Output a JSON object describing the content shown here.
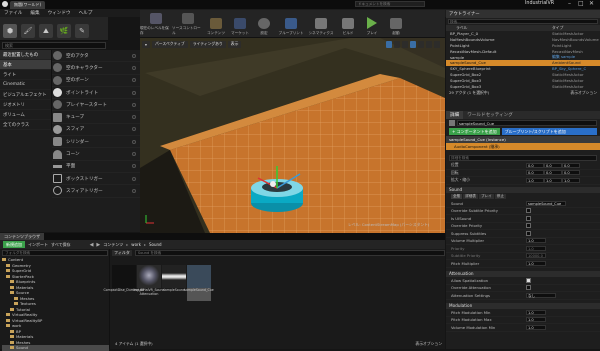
{
  "document_tab": "無題(ワールド)",
  "window_title": "IndustrialVR",
  "help_search_placeholder": "ドキュメントを検索",
  "menu": [
    "ファイル",
    "編集",
    "ウィンドウ",
    "ヘルプ"
  ],
  "modes_title": "モード",
  "place_search_placeholder": "検索",
  "place_categories": [
    "最近配置したもの",
    "基本",
    "ライト",
    "Cinematic",
    "ビジュアルエフェクト",
    "ジオメトリ",
    "ボリューム",
    "全てのクラス"
  ],
  "place_items": [
    "空のアクタ",
    "空のキャラクター",
    "空のポーン",
    "ポイントライト",
    "プレイヤースタート",
    "キューブ",
    "スフィア",
    "シリンダー",
    "コーン",
    "平面",
    "ボックストリガー",
    "スフィアトリガー"
  ],
  "toolbar": [
    "現在のレベルを保存",
    "ソースコントロール",
    "コンテンツ",
    "マーケット",
    "設定",
    "ブループリント",
    "シネマティクス",
    "ビルド",
    "プレイ",
    "起動"
  ],
  "viewport": {
    "perspective": "パースペクティブ",
    "lit": "ライティングあり",
    "show": "表示",
    "status": "レベル: ContentStreamMap (パーシスタント)"
  },
  "outliner": {
    "title": "アウトライナー",
    "search_placeholder": "検索...",
    "col_label": "ラベル",
    "col_type": "タイプ",
    "rows": [
      {
        "label": "BP_Player_C_0",
        "type": "StaticMeshActor"
      },
      {
        "label": "NoMeshBoundsVolume",
        "type": "NavMeshBoundsVolume"
      },
      {
        "label": "PointLight",
        "type": "PointLight"
      },
      {
        "label": "RecastNavMesh-Default",
        "type": "RecastNavMesh"
      },
      {
        "label": "sample",
        "type": "編集 sample"
      },
      {
        "label": "sampleSound_Cue",
        "type": "AmbientSound"
      },
      {
        "label": "SKY_SphereBlueprint",
        "type": "BP_Sky_Sphere_C"
      },
      {
        "label": "SuperGrid_Box2",
        "type": "StaticMeshActor"
      },
      {
        "label": "SuperGrid_Box3",
        "type": "StaticMeshActor"
      },
      {
        "label": "SuperGrid_Box3",
        "type": "StaticMeshActor"
      }
    ],
    "footer": "29 アクタ (1 を選択中)",
    "view_options": "表示オプション"
  },
  "details": {
    "tab": "詳細",
    "tab2": "ワールドセッティング",
    "actor_name": "sampleSound_Cue",
    "add_component": "+ コンポーネントを追加",
    "blueprint_button": "ブループリント/スクリプトを追加",
    "instance": "sampleSound_Cue (Instance)",
    "component": "AudioComponent (継承)",
    "search_placeholder": "詳細を検索",
    "transform": {
      "location": "位置",
      "rotation": "回転",
      "scale": "拡大・縮小"
    },
    "sound_section": "Sound",
    "sound_tabs": [
      "全般",
      "詳細表",
      "プレイ",
      "停止"
    ],
    "sound_label": "Sound",
    "sound_value": "sampleSound_Cue",
    "sound_rows": [
      {
        "label": "Override Subtitle Priority",
        "v": "chk"
      },
      {
        "label": "Is UISound",
        "v": "chk"
      },
      {
        "label": "Override Priority",
        "v": "chk"
      },
      {
        "label": "Suppress Subtitles",
        "v": "chk"
      },
      {
        "label": "Volume Multiplier",
        "v": "1.0"
      },
      {
        "label": "Priority",
        "v": "1.0"
      },
      {
        "label": "Subtitle Priority",
        "v": "10000.0"
      },
      {
        "label": "Pitch Multiplier",
        "v": "1.0"
      }
    ],
    "attenuation_section": "Attenuation",
    "attenuation_rows": [
      {
        "label": "Allow Spatialization",
        "v": "chkon"
      },
      {
        "label": "Override Attenuation",
        "v": "chk"
      },
      {
        "label": "Attenuation Settings",
        "v": "なし"
      }
    ],
    "modulation_section": "Modulation",
    "modulation_rows": [
      {
        "label": "Pitch Modulation Min",
        "v": "1.0"
      },
      {
        "label": "Pitch Modulation Max",
        "v": "1.0"
      },
      {
        "label": "Volume Modulation Min",
        "v": "1.0"
      }
    ]
  },
  "content_browser": {
    "tab": "コンテンツブラウザ",
    "add_new": "新規追加",
    "import": "インポート",
    "save_all": "すべて保存",
    "folder_search_placeholder": "フォルダを検索",
    "filter": "フィルタ",
    "asset_search_placeholder": "Sound を検索",
    "path": [
      "コンテンツ",
      "work",
      "Sound"
    ],
    "tree": [
      "Content",
      "Geometry",
      "SuperGrid",
      "StarterPack",
      "Blueprints",
      "Materials",
      "Source",
      "Meshes",
      "Textures",
      "Tutorial",
      "VirtualReality",
      "VirtualRealityBP",
      "work",
      "BP",
      "Materials",
      "Meshes",
      "Sound",
      "UI"
    ],
    "assets": [
      "CompactDise_Dummy_BP",
      "IndustrialVR_Sound Attenuation",
      "sampleSound",
      "sampleSound_Cue"
    ],
    "footer": "4 アイテム (1 選択中)",
    "view_options": "表示オプション"
  }
}
